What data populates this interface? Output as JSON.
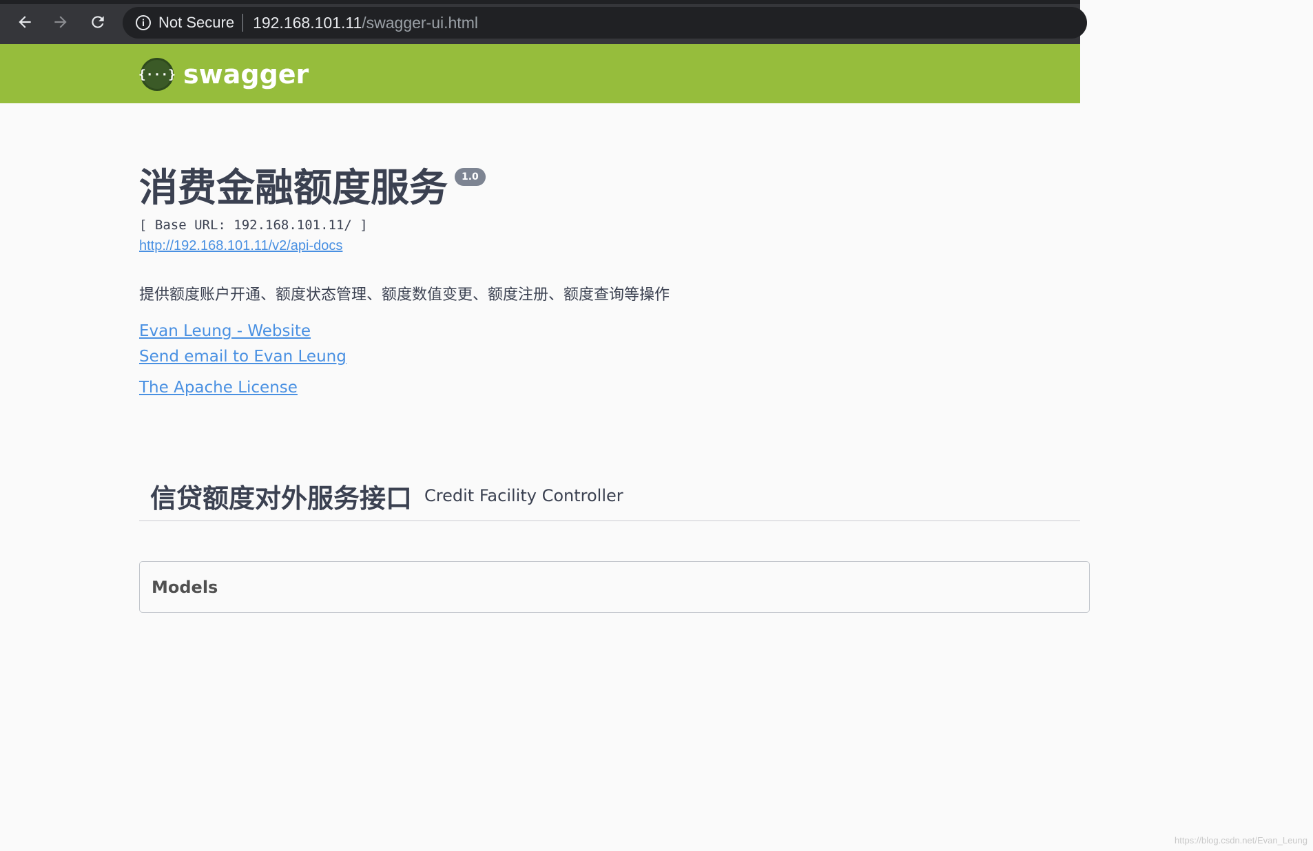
{
  "browser": {
    "security_label": "Not Secure",
    "url_host": "192.168.101.11",
    "url_path": "/swagger-ui.html"
  },
  "topbar": {
    "logo_glyph": "{···}",
    "logo_text": "swagger",
    "color": "#96bd3c"
  },
  "info": {
    "title": "消费金融额度服务",
    "version": "1.0",
    "base_url": "[ Base URL: 192.168.101.11/ ]",
    "docs_url": "http://192.168.101.11/v2/api-docs",
    "description": "提供额度账户开通、额度状态管理、额度数值变更、额度注册、额度查询等操作",
    "contact_website": "Evan Leung - Website",
    "contact_email": "Send email to Evan Leung",
    "license": "The Apache License"
  },
  "tag": {
    "name": "信贷额度对外服务接口",
    "description": "Credit Facility Controller"
  },
  "models": {
    "title": "Models"
  },
  "watermark": "https://blog.csdn.net/Evan_Leung",
  "colors": {
    "link": "#4990e2",
    "text": "#3b4151",
    "version_badge": "#7d8492"
  }
}
